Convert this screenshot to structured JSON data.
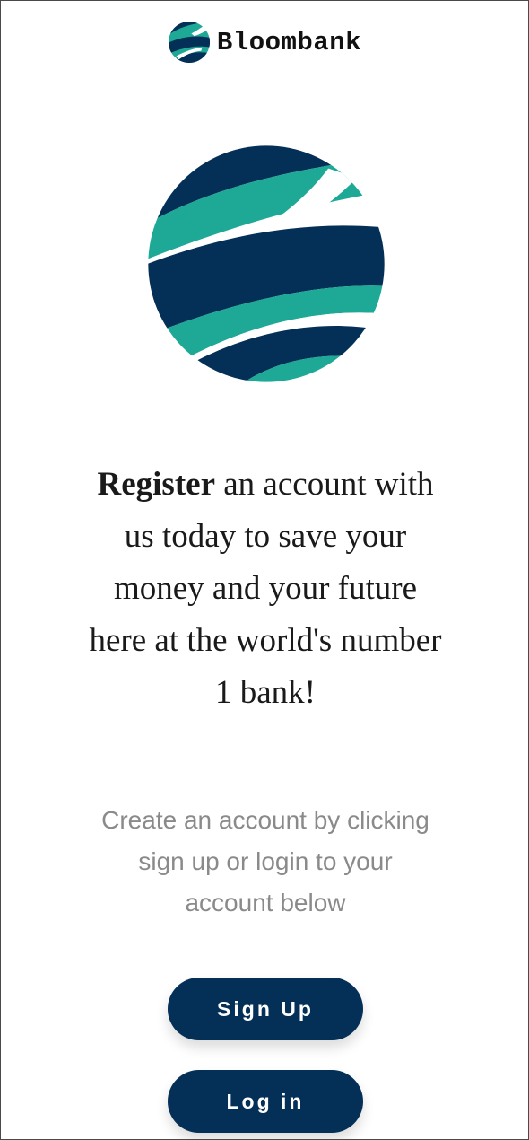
{
  "header": {
    "brand_name": "Bloombank",
    "logo_icon": "striped-globe-icon"
  },
  "hero": {
    "logo_icon": "striped-globe-icon"
  },
  "headline": {
    "bold": "Register",
    "rest": " an account with us today to save your money and your future here at the world's number 1 bank!"
  },
  "subtext": "Create an account by clicking sign up or login to your account below",
  "actions": {
    "signup_label": "Sign Up",
    "login_label": "Log in"
  },
  "colors": {
    "navy": "#042f57",
    "teal": "#1ea996",
    "subtext": "#8a8a8a",
    "background": "#ffffff"
  }
}
